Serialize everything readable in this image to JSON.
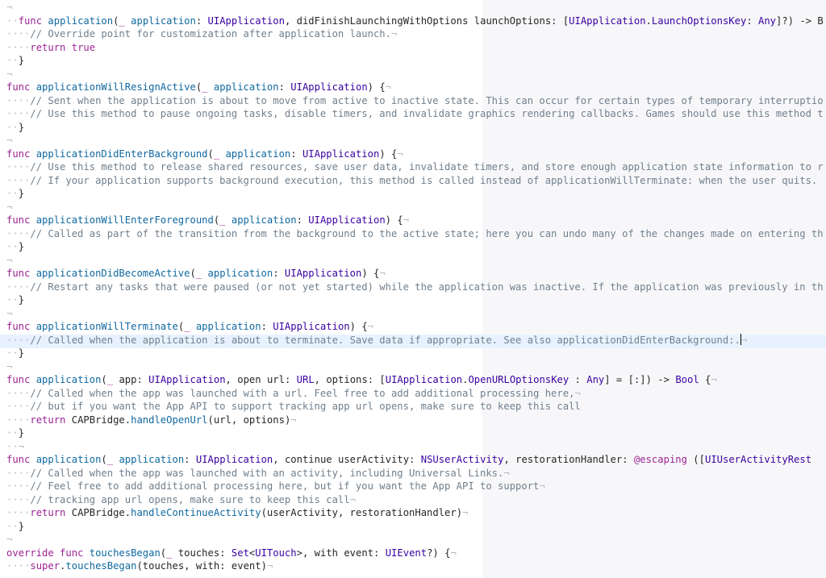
{
  "editor": {
    "tokens": [
      "¬",
      "func",
      "application(_ application: UIApplication, didFinishLaunchingWithOptions launchOptions: [UIApplication.LaunchOptionsKey: Any]?) -> B",
      "// Override point for customization after application launch.",
      "return",
      "true",
      "}",
      "func",
      "applicationWillResignActive(_ application: UIApplication) {",
      "// Sent when the application is about to move from active to inactive state. This can occur for certain types of temporary interruptio",
      "// Use this method to pause ongoing tasks, disable timers, and invalidate graphics rendering callbacks. Games should use this method t",
      "func",
      "applicationDidEnterBackground(_ application: UIApplication) {",
      "// Use this method to release shared resources, save user data, invalidate timers, and store enough application state information to r",
      "// If your application supports background execution, this method is called instead of applicationWillTerminate: when the user quits.",
      "func",
      "applicationWillEnterForeground(_ application: UIApplication) {",
      "// Called as part of the transition from the background to the active state; here you can undo many of the changes made on entering th",
      "func",
      "applicationDidBecomeActive(_ application: UIApplication) {",
      "// Restart any tasks that were paused (or not yet started) while the application was inactive. If the application was previously in th",
      "func",
      "applicationWillTerminate(_ application: UIApplication) {",
      "// Called when the application is about to terminate. Save data if appropriate. See also applicationDidEnterBackground:.",
      "func",
      "application(_ app: UIApplication, open url: URL, options: [UIApplication.OpenURLOptionsKey : Any] = [:]) -> Bool {",
      "// Called when the app was launched with a url. Feel free to add additional processing here,",
      "// but if you want the App API to support tracking app url opens, make sure to keep this call",
      "return",
      "CAPBridge.handleOpenUrl(url, options)",
      "func",
      "application(_ application: UIApplication, continue userActivity: NSUserActivity, restorationHandler: @escaping ([UIUserActivityRest",
      "// Called when the app was launched with an activity, including Universal Links.",
      "// Feel free to add additional processing here, but if you want the App API to support",
      "// tracking app url opens, make sure to keep this call",
      "return",
      "CAPBridge.handleContinueActivity(userActivity, restorationHandler)",
      "override func",
      "touchesBegan(_ touches: Set<UITouch>, with event: UIEvent?) {",
      "super.touchesBegan(touches, with: event)"
    ],
    "colors": {
      "background": "#ffffff",
      "right_pane": "#f7f7f9",
      "current_line": "#e8f2ff",
      "keyword": "#9b2393",
      "method": "#0f68a0",
      "type": "#3900a0",
      "comment": "#707f8c",
      "invisibles": "#b9b9c3",
      "plain": "#262626"
    }
  }
}
